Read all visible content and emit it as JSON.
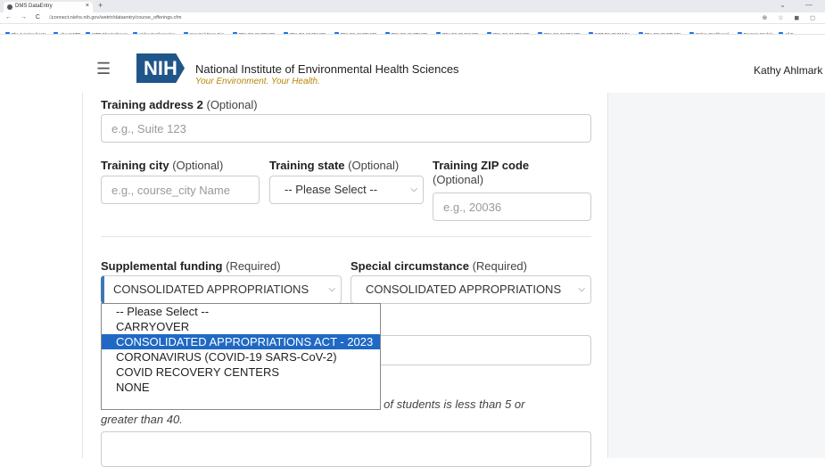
{
  "browser": {
    "tab_title": "DMS DataEntry",
    "tab_close": "×",
    "new_tab": "+",
    "window_controls": "⌄ —",
    "nav_buttons": "← → C ⌂",
    "url": "connect.niehs.nih.gov/wetrtr/dataentry/course_offerings.cfm",
    "addr_icons": "⊕ ☆ ◼ ◻",
    "bookmarks": [
      "The Junction for W...",
      "About WTP",
      "WTP Clearinghouse",
      "Video Conferencing...",
      "Imported From Fire...",
      "RFA-ES-19-008 SBI...",
      "RFA-ES-17-004 SBI...",
      "RFA-ES-18-006 SBI...",
      "RFA-ES-19-008 SBI...",
      "RFA-ES-20-012 SBI...",
      "RFA-ES-21-003 SBI...",
      "RFA-ES-22-004 SBI...",
      "NOT-ES-23-012 Fo...",
      "RFA-ES-23-005 SBI...",
      "Webco Dashboard...",
      "Program Module",
      "All B"
    ]
  },
  "header": {
    "logo": "NIH",
    "org_name": "National Institute of Environmental Health Sciences",
    "tagline": "Your Environment. Your Health.",
    "user_name": "Kathy Ahlmark"
  },
  "form": {
    "address2": {
      "label": "Training address 2",
      "opt": " (Optional)",
      "placeholder": "e.g., Suite 123"
    },
    "city": {
      "label": "Training city",
      "opt": " (Optional)",
      "placeholder": "e.g., course_city Name"
    },
    "state": {
      "label": "Training state",
      "opt": " (Optional)",
      "value": "-- Please Select --"
    },
    "zip": {
      "label": "Training ZIP code",
      "opt": "(Optional)",
      "placeholder": "e.g., 20036"
    },
    "funding": {
      "label": "Supplemental funding",
      "opt": " (Required)",
      "value": "CONSOLIDATED APPROPRIATIONS",
      "options": [
        "-- Please Select --",
        "CARRYOVER",
        "CONSOLIDATED APPROPRIATIONS ACT - 2023",
        "CORONAVIRUS (COVID-19 SARS-CoV-2)",
        "COVID RECOVERY CENTERS",
        "NONE"
      ],
      "selected_index": 2
    },
    "special": {
      "label": "Special circumstance",
      "opt": " (Required)",
      "value": "CONSOLIDATED APPROPRIATIONS"
    },
    "note_line1": "er of students is less than 5 or",
    "note_line2": "greater than 40."
  }
}
